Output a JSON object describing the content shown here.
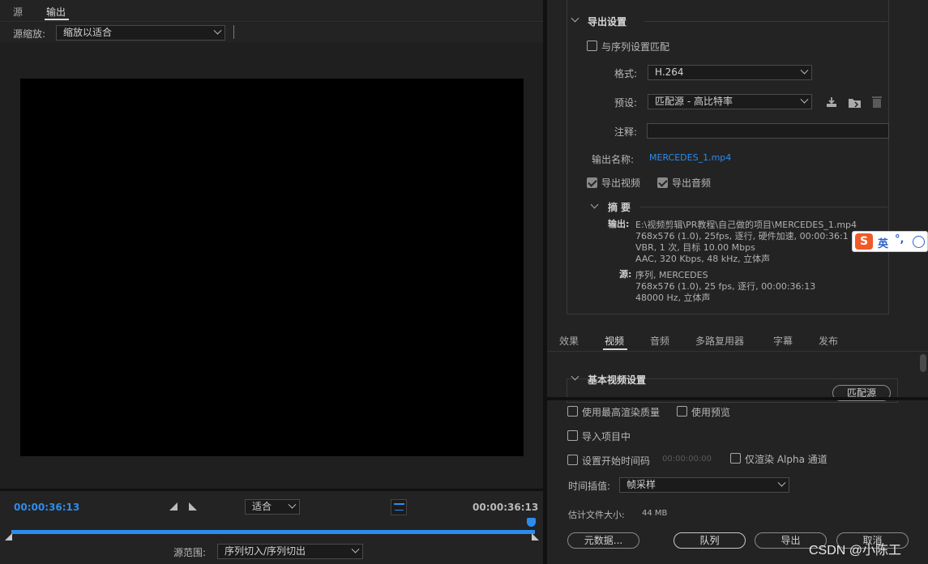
{
  "left": {
    "tabs": [
      {
        "label": "源"
      },
      {
        "label": "输出"
      }
    ],
    "source_scale_label": "源缩放:",
    "source_scale_value": "缩放以适合",
    "timecode_left": "00:00:36:13",
    "timecode_right": "00:00:36:13",
    "fit_value": "适合",
    "source_range_label": "源范围:",
    "source_range_value": "序列切入/序列切出",
    "progress_fraction": 1.0
  },
  "export": {
    "section_title": "导出设置",
    "match_sequence_label": "与序列设置匹配",
    "format_label": "格式:",
    "format_value": "H.264",
    "preset_label": "预设:",
    "preset_value": "匹配源 - 高比特率",
    "comment_label": "注释:",
    "output_name_label": "输出名称:",
    "output_name_value": "MERCEDES_1.mp4",
    "export_video_label": "导出视频",
    "export_audio_label": "导出音频",
    "summary_title": "摘要",
    "output_key": "输出:",
    "output_lines": [
      "E:\\视频剪辑\\PR教程\\自己做的项目\\MERCEDES_1.mp4",
      "768x576 (1.0), 25fps, 逐行, 硬件加速, 00:00:36:1",
      "VBR, 1 次, 目标 10.00 Mbps",
      "AAC, 320 Kbps, 48 kHz, 立体声"
    ],
    "source_key": "源:",
    "source_lines": [
      "序列, MERCEDES",
      "768x576 (1.0), 25 fps, 逐行, 00:00:36:13",
      "48000 Hz, 立体声"
    ],
    "ime_label": "英"
  },
  "tabs2": [
    {
      "label": "效果"
    },
    {
      "label": "视频"
    },
    {
      "label": "音频"
    },
    {
      "label": "多路复用器"
    },
    {
      "label": "字幕"
    },
    {
      "label": "发布"
    }
  ],
  "video": {
    "basic_title": "基本视频设置",
    "match_source_button": "匹配源"
  },
  "bottom": {
    "max_quality_label": "使用最高渲染质量",
    "use_preview_label": "使用预览",
    "import_project_label": "导入项目中",
    "set_start_tc_label": "设置开始时间码",
    "start_tc_value": "00:00:00:00",
    "alpha_only_label": "仅渲染 Alpha 通道",
    "time_interp_label": "时间插值:",
    "time_interp_value": "帧采样",
    "file_size_label": "估计文件大小:",
    "file_size_value": "44 MB",
    "metadata_button": "元数据...",
    "queue_button": "队列",
    "export_button": "导出",
    "cancel_button": "取消"
  },
  "watermark": "CSDN @小陈工",
  "colors": {
    "accent": "#2d8ceb",
    "panel": "#232323",
    "video_bg": "#000000"
  }
}
